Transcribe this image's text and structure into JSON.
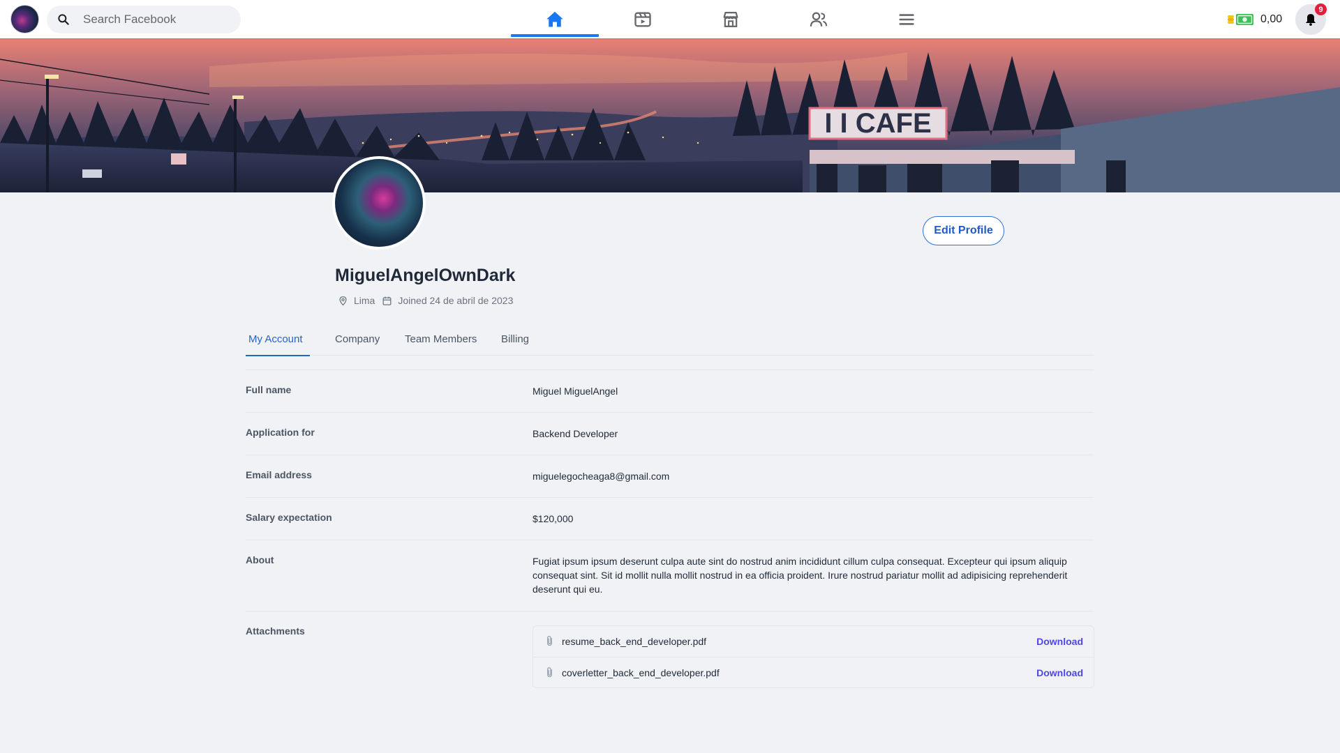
{
  "colors": {
    "accent": "#1877f2",
    "tab_active": "#2563c9",
    "download_link": "#4f46e5",
    "badge": "#e41e3f"
  },
  "header": {
    "logo_icon": "app-logo",
    "search": {
      "placeholder": "Search Facebook",
      "icon": "search-icon"
    },
    "nav_tabs": [
      {
        "icon": "home-icon",
        "active": true
      },
      {
        "icon": "video-icon",
        "active": false
      },
      {
        "icon": "marketplace-icon",
        "active": false
      },
      {
        "icon": "friends-icon",
        "active": false
      },
      {
        "icon": "menu-icon",
        "active": false
      }
    ],
    "wallet": {
      "icon": "coins-cash-icon",
      "amount": "0,00"
    },
    "notifications": {
      "icon": "bell-icon",
      "badge": "9"
    }
  },
  "cover": {
    "sign_text": "I I CAFE"
  },
  "profile": {
    "name": "MiguelAngelOwnDark",
    "location": "Lima",
    "joined": "Joined 24 de abril de 2023",
    "edit_button": "Edit Profile"
  },
  "tabs": [
    "My Account",
    "Company",
    "Team Members",
    "Billing"
  ],
  "active_tab": "My Account",
  "details": {
    "full_name": {
      "label": "Full name",
      "value": "Miguel MiguelAngel"
    },
    "application": {
      "label": "Application for",
      "value": "Backend Developer"
    },
    "email": {
      "label": "Email address",
      "value": "miguelegocheaga8@gmail.com"
    },
    "salary": {
      "label": "Salary expectation",
      "value": "$120,000"
    },
    "about": {
      "label": "About",
      "value": "Fugiat ipsum ipsum deserunt culpa aute sint do nostrud anim incididunt cillum culpa consequat. Excepteur qui ipsum aliquip consequat sint. Sit id mollit nulla mollit nostrud in ea officia proident. Irure nostrud pariatur mollit ad adipisicing reprehenderit deserunt qui eu."
    },
    "attachments": {
      "label": "Attachments",
      "files": [
        {
          "name": "resume_back_end_developer.pdf",
          "action": "Download"
        },
        {
          "name": "coverletter_back_end_developer.pdf",
          "action": "Download"
        }
      ]
    }
  }
}
